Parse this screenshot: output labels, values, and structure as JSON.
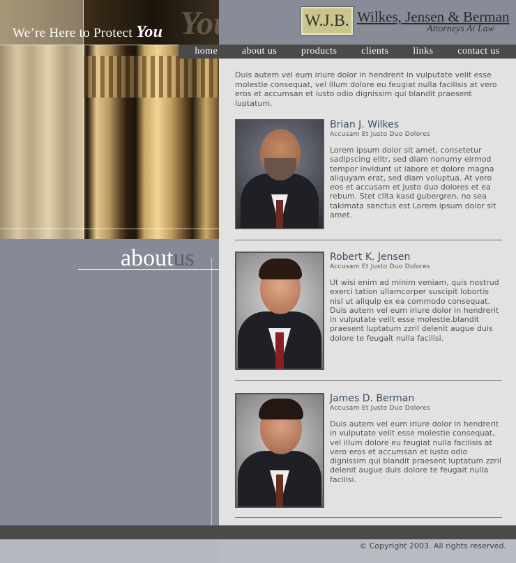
{
  "colors": {
    "nav_bg": "#4a4a4a",
    "left_panel": "#858a96",
    "main_bg": "#e2e2e2",
    "name_color": "#3b4d66"
  },
  "header": {
    "tagline_prefix": "We’re Here to Protect ",
    "tagline_emphasis": "You",
    "logo_monogram": "W.J.B.",
    "firm_name": "Wilkes, Jensen & Berman",
    "firm_subtitle": "Attorneys At Law"
  },
  "nav": {
    "items": [
      {
        "label": "home"
      },
      {
        "label": "about us"
      },
      {
        "label": "products"
      },
      {
        "label": "clients"
      },
      {
        "label": "links"
      },
      {
        "label": "contact us"
      }
    ]
  },
  "section": {
    "title_main": "about",
    "title_accent": "us"
  },
  "intro": "Duis autem vel eum iriure dolor in hendrerit in vulputate velit esse molestie consequat, vel illum dolore eu feugiat nulla facilisis at vero eros et accumsan et iusto odio dignissim qui blandit praesent luptatum.",
  "people": [
    {
      "name": "Brian J. Wilkes",
      "subtitle": "Accusam Et Justo Duo Dolores",
      "bio": "Lorem ipsum dolor sit amet, consetetur sadipscing elitr, sed diam nonumy eirmod tempor invidunt ut labore et dolore magna aliquyam erat, sed diam voluptua. At vero eos et accusam et justo duo dolores et ea rebum. Stet clita kasd gubergren, no sea takimata sanctus est Lorem ipsum dolor sit amet."
    },
    {
      "name": "Robert K. Jensen",
      "subtitle": "Accusam Et Justo Duo Dolores",
      "bio": "Ut wisi enim ad minim veniam, quis nostrud exerci tation ullamcorper suscipit lobortis nisl ut aliquip ex ea commodo consequat. Duis autem vel eum iriure dolor in hendrerit in vulputate velit esse molestie.blandit praesent luptatum zzril delenit augue duis dolore te feugait nulla facilisi."
    },
    {
      "name": "James D. Berman",
      "subtitle": "Accusam Et Justo Duo Dolores",
      "bio": "Duis autem vel eum iriure dolor in hendrerit in vulputate velit esse molestie consequat, vel illum dolore eu feugiat nulla facilisis at vero eros et accumsan et iusto odio dignissim qui blandit praesent luptatum zzril delenit augue duis dolore te feugait nulla facilisi."
    }
  ],
  "footer": {
    "copyright": "© Copyright 2003. All rights reserved."
  }
}
